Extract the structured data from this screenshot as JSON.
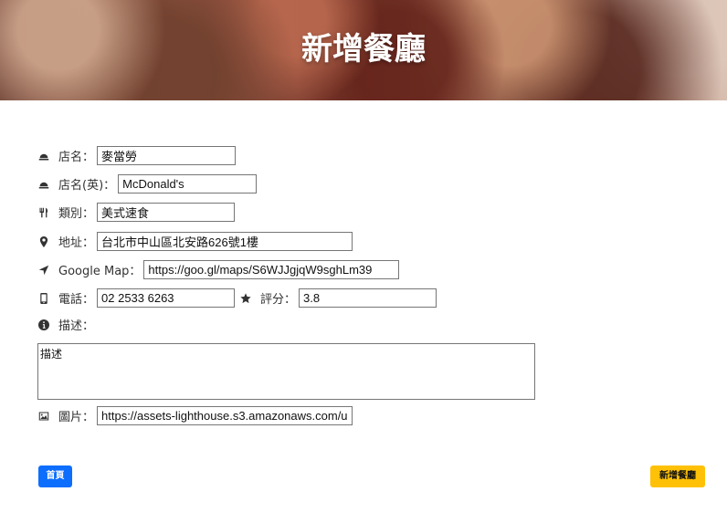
{
  "banner": {
    "title": "新增餐廳"
  },
  "form": {
    "name": {
      "label": "店名：",
      "value": "麥當勞",
      "icon": "bell-icon"
    },
    "name_en": {
      "label": "店名(英)：",
      "value": "McDonald's",
      "icon": "bell-icon"
    },
    "category": {
      "label": "類別：",
      "value": "美式速食",
      "icon": "utensils-icon"
    },
    "location": {
      "label": "地址：",
      "value": "台北市中山區北安路626號1樓",
      "icon": "map-marker-icon"
    },
    "google_map": {
      "label": "Google Map：",
      "value": "https://goo.gl/maps/S6WJJgjqW9sghLm39",
      "icon": "location-arrow-icon"
    },
    "phone": {
      "label": "電話：",
      "value": "02 2533 6263",
      "icon": "mobile-icon"
    },
    "rating": {
      "label": "評分：",
      "value": "3.8",
      "icon": "star-icon"
    },
    "description": {
      "label": "描述：",
      "value": "描述",
      "icon": "info-circle-icon"
    },
    "image": {
      "label": "圖片：",
      "value": "https://assets-lighthouse.s3.amazonaws.com/u",
      "icon": "image-icon"
    }
  },
  "buttons": {
    "home": "首頁",
    "submit": "新增餐廳"
  },
  "colors": {
    "primary": "#0d6efd",
    "warning": "#ffc107"
  }
}
